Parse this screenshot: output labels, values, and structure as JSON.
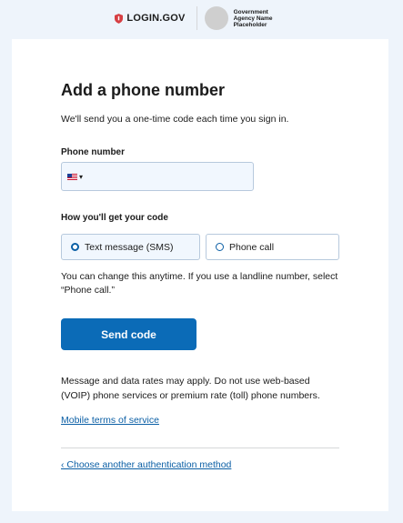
{
  "header": {
    "logo_text": "LOGIN.GOV",
    "agency_name": "Government Agency Name Placeholder"
  },
  "main": {
    "title": "Add a phone number",
    "intro": "We'll send you a one-time code each time you sign in.",
    "phone_label": "Phone number",
    "phone_value": "",
    "country_flag": "us-flag-icon",
    "delivery_label": "How you'll get your code",
    "options": [
      {
        "label": "Text message (SMS)",
        "selected": true
      },
      {
        "label": "Phone call",
        "selected": false
      }
    ],
    "hint": "You can change this anytime. If you use a landline number, select “Phone call.”",
    "send_button": "Send code",
    "disclaimer": "Message and data rates may apply. Do not use web-based (VOIP) phone services or premium rate (toll) phone numbers.",
    "terms_link": "Mobile terms of service",
    "back_link": "‹ Choose another authentication method"
  },
  "colors": {
    "page_bg": "#eef4fb",
    "primary": "#0b6bb7",
    "link": "#0b5fa5",
    "logo_red": "#d63e42"
  }
}
